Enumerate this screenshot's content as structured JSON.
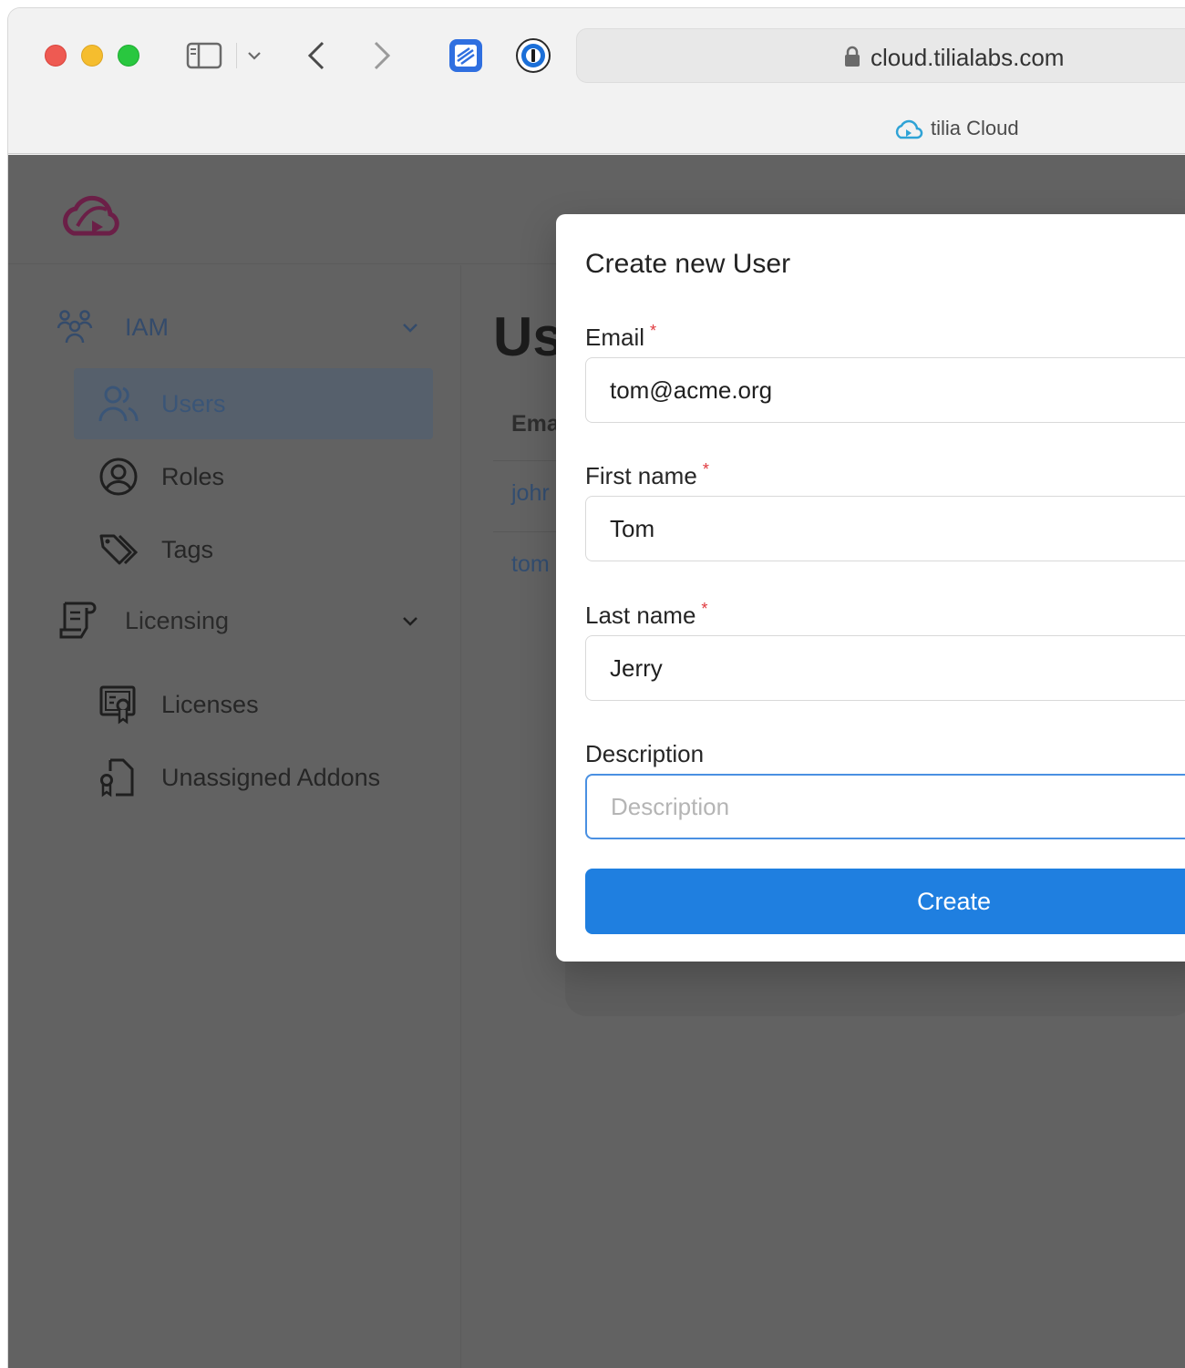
{
  "browser": {
    "url": "cloud.tilialabs.com",
    "tab_title": "tilia Cloud"
  },
  "sidebar": {
    "groups": [
      {
        "label": "IAM",
        "icon": "users-group-icon",
        "expanded": true
      },
      {
        "label": "Licensing",
        "icon": "license-scroll-icon",
        "expanded": true
      }
    ],
    "items": [
      {
        "label": "Users",
        "icon": "users-icon",
        "active": true
      },
      {
        "label": "Roles",
        "icon": "user-circle-icon",
        "active": false
      },
      {
        "label": "Tags",
        "icon": "tags-icon",
        "active": false
      },
      {
        "label": "Licenses",
        "icon": "certificate-icon",
        "active": false
      },
      {
        "label": "Unassigned Addons",
        "icon": "addon-document-icon",
        "active": false
      }
    ]
  },
  "main": {
    "title": "Us",
    "column_header": "Ema",
    "rows": [
      "johr",
      "tom"
    ]
  },
  "modal": {
    "title": "Create new User",
    "required_marker": "*",
    "fields": {
      "email": {
        "label": "Email",
        "value": "tom@acme.org"
      },
      "first_name": {
        "label": "First name",
        "value": "Tom"
      },
      "last_name": {
        "label": "Last name",
        "value": "Jerry"
      },
      "description": {
        "label": "Description",
        "value": "",
        "placeholder": "Description"
      }
    },
    "create_label": "Create"
  },
  "colors": {
    "accent": "#1f7fe0",
    "required": "#e0393e",
    "overlay": "#626262",
    "logo": "#7a2450"
  }
}
